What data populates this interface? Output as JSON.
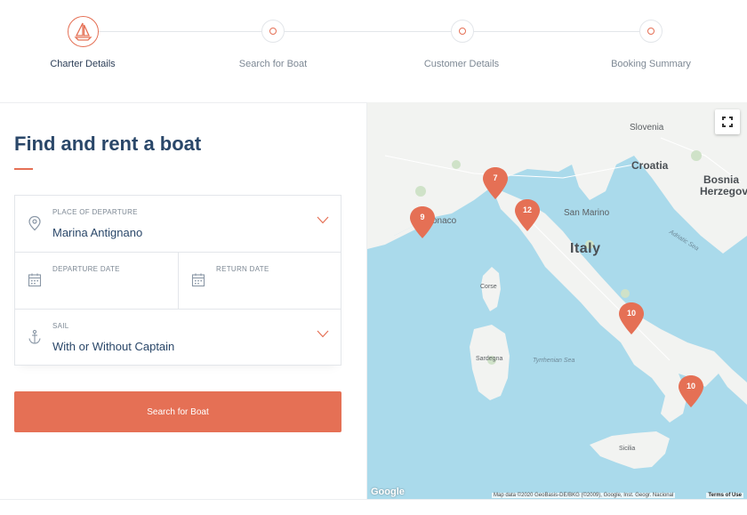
{
  "stepper": {
    "steps": [
      {
        "label": "Charter Details",
        "active": true
      },
      {
        "label": "Search for Boat",
        "active": false
      },
      {
        "label": "Customer Details",
        "active": false
      },
      {
        "label": "Booking Summary",
        "active": false
      }
    ]
  },
  "search_form": {
    "title": "Find and rent a boat",
    "departure_place": {
      "label": "PLACE OF DEPARTURE",
      "value": "Marina Antignano",
      "icon": "location-pin-icon"
    },
    "departure_date": {
      "label": "DEPARTURE DATE",
      "value": "",
      "icon": "calendar-icon"
    },
    "return_date": {
      "label": "RETURN DATE",
      "value": "",
      "icon": "calendar-icon"
    },
    "sail": {
      "label": "SAIL",
      "value": "With or Without Captain",
      "icon": "anchor-icon"
    },
    "submit_label": "Search for Boat"
  },
  "map": {
    "labels": {
      "slovenia": "Slovenia",
      "croatia": "Croatia",
      "bosnia_1": "Bosnia",
      "bosnia_2": "Herzegov",
      "san_marino": "San Marino",
      "italy": "Italy",
      "monaco": "onaco",
      "corse": "Corse",
      "sardegna": "Sardegna",
      "tyrrhenian": "Tyrrhenian Sea",
      "adriatic": "Adriatic Sea",
      "sicilia": "Sicilia"
    },
    "markers": [
      {
        "count": "7"
      },
      {
        "count": "9"
      },
      {
        "count": "12"
      },
      {
        "count": "10"
      },
      {
        "count": "10"
      }
    ],
    "attribution": "Map data ©2020 GeoBasis-DE/BKG (©2009), Google, Inst. Geogr. Nacional",
    "terms": "Terms of Use",
    "google": "Google"
  },
  "colors": {
    "accent": "#e57055",
    "navy": "#2a4769",
    "sea": "#aadaeb",
    "land": "#f2f3f1"
  }
}
